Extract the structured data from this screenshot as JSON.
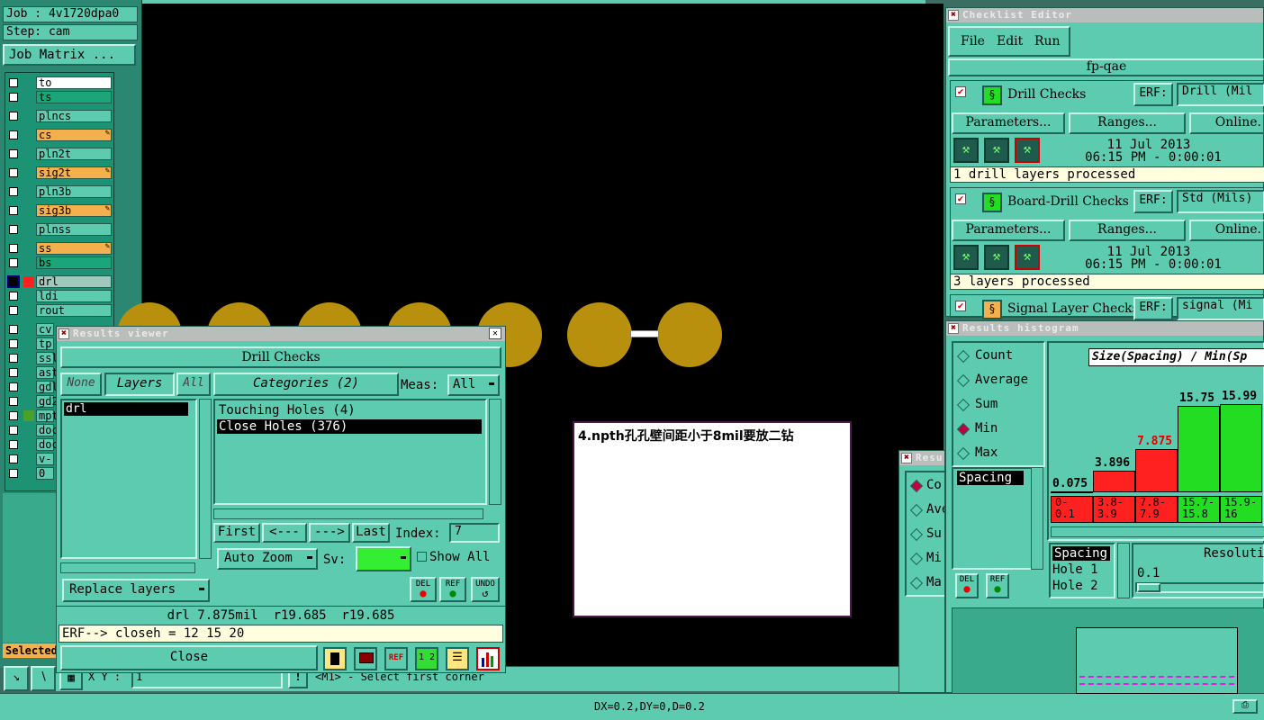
{
  "job": {
    "job_label": "Job : 4v1720dpa0",
    "step_label": "Step: cam",
    "matrix_button": "Job Matrix ..."
  },
  "layers": [
    {
      "name": "to",
      "color": "#ffffff"
    },
    {
      "name": "ts",
      "color": "#1aa679"
    },
    {
      "name": "plncs",
      "color": "#5ccbb0"
    },
    {
      "name": "cs",
      "color": "#f4b04c"
    },
    {
      "name": "pln2t",
      "color": "#5ccbb0"
    },
    {
      "name": "sig2t",
      "color": "#f4b04c"
    },
    {
      "name": "pln3b",
      "color": "#5ccbb0"
    },
    {
      "name": "sig3b",
      "color": "#f4b04c"
    },
    {
      "name": "plnss",
      "color": "#5ccbb0"
    },
    {
      "name": "ss",
      "color": "#f4b04c"
    },
    {
      "name": "bs",
      "color": "#1aa679"
    },
    {
      "name": "drl",
      "color": "#a0c9bd"
    },
    {
      "name": "ldi",
      "color": "#5ccbb0"
    },
    {
      "name": "rout",
      "color": "#5ccbb0"
    },
    {
      "name": "cv",
      "color": "#5ccbb0"
    },
    {
      "name": "tp",
      "color": "#5ccbb0"
    },
    {
      "name": "ssl",
      "color": "#5ccbb0"
    },
    {
      "name": "ast",
      "color": "#5ccbb0"
    },
    {
      "name": "gdl",
      "color": "#5ccbb0"
    },
    {
      "name": "gd2",
      "color": "#5ccbb0"
    },
    {
      "name": "mpt",
      "color": "#5ccbb0"
    },
    {
      "name": "doc",
      "color": "#5ccbb0"
    },
    {
      "name": "doc",
      "color": "#5ccbb0"
    },
    {
      "name": "v-c",
      "color": "#5ccbb0"
    },
    {
      "name": "0",
      "color": "#5ccbb0"
    }
  ],
  "selected_label": "Selected",
  "coord_label": "X Y :",
  "coord_value": "1",
  "status_hint": "<M1> - Select first corner",
  "status_bar": "DX=0.2,DY=0,D=0.2",
  "annotation": "4.npth孔孔壁间距小于8mil要放二钻",
  "results_viewer": {
    "title": "Results viewer",
    "header": "Drill Checks",
    "none_btn": "None",
    "layers_btn": "Layers",
    "all_btn": "All",
    "categories_btn": "Categories (2)",
    "meas_label": "Meas:",
    "meas_value": "All",
    "layer_items": [
      "drl"
    ],
    "categories": [
      "Touching Holes (4)",
      "Close Holes (376)"
    ],
    "first_btn": "First",
    "prev_btn": "<---",
    "next_btn": "--->",
    "last_btn": "Last",
    "index_label": "Index:",
    "index_value": "7",
    "auto_zoom": "Auto Zoom",
    "sv_label": "Sv:",
    "show_all": "Show All",
    "replace_layers": "Replace layers",
    "del_label": "DEL",
    "ref_label": "REF",
    "undo_label": "UNDO",
    "measure_readout": "drl 7.875mil  r19.685  r19.685",
    "erf_line": "ERF--> closeh = 12 15 20",
    "close_btn": "Close"
  },
  "checklist": {
    "title": "Checklist Editor",
    "menu": [
      "File",
      "Edit",
      "Run"
    ],
    "name": "fp-qae",
    "erf_label": "ERF:",
    "parameters_btn": "Parameters...",
    "ranges_btn": "Ranges...",
    "online_btn": "Online.",
    "checks": [
      {
        "name": "Drill Checks",
        "erf": "Drill (Mil",
        "date": "11 Jul 2013",
        "time": "06:15 PM - 0:00:01",
        "status": "1 drill layers processed"
      },
      {
        "name": "Board-Drill Checks",
        "erf": "Std (Mils)",
        "date": "11 Jul 2013",
        "time": "06:15 PM - 0:00:01",
        "status": "3 layers processed"
      },
      {
        "name": "Signal Layer Checks",
        "erf": "signal (Mi",
        "date": "",
        "time": "",
        "status": ""
      }
    ]
  },
  "histogram": {
    "title": "Results histogram",
    "modes": [
      "Count",
      "Average",
      "Sum",
      "Min",
      "Max"
    ],
    "selected_mode": "Min",
    "chart_title": "Size(Spacing) / Min(Sp",
    "list_items": [
      "Spacing"
    ],
    "fields": [
      "Spacing",
      "Hole 1",
      "Hole 2"
    ],
    "resolution_label": "Resoluti",
    "resolution_value": "0.1",
    "del_label": "DEL",
    "ref_label": "REF"
  },
  "chart_data": {
    "type": "bar",
    "categories": [
      "0-\n0.1",
      "3.8-\n3.9",
      "7.8-\n7.9",
      "15.7-\n15.8",
      "15.9-\n16"
    ],
    "values": [
      0.075,
      3.896,
      7.875,
      15.75,
      15.99
    ],
    "value_labels": [
      "0.075",
      "3.896",
      "7.875",
      "15.75",
      "15.99"
    ],
    "colors": [
      "#ff2020",
      "#ff2020",
      "#ff2020",
      "#22dd22",
      "#22dd22"
    ]
  },
  "small_window": {
    "title": "Resu",
    "modes": [
      "Co",
      "Ave",
      "Su",
      "Mi",
      "Ma"
    ]
  }
}
